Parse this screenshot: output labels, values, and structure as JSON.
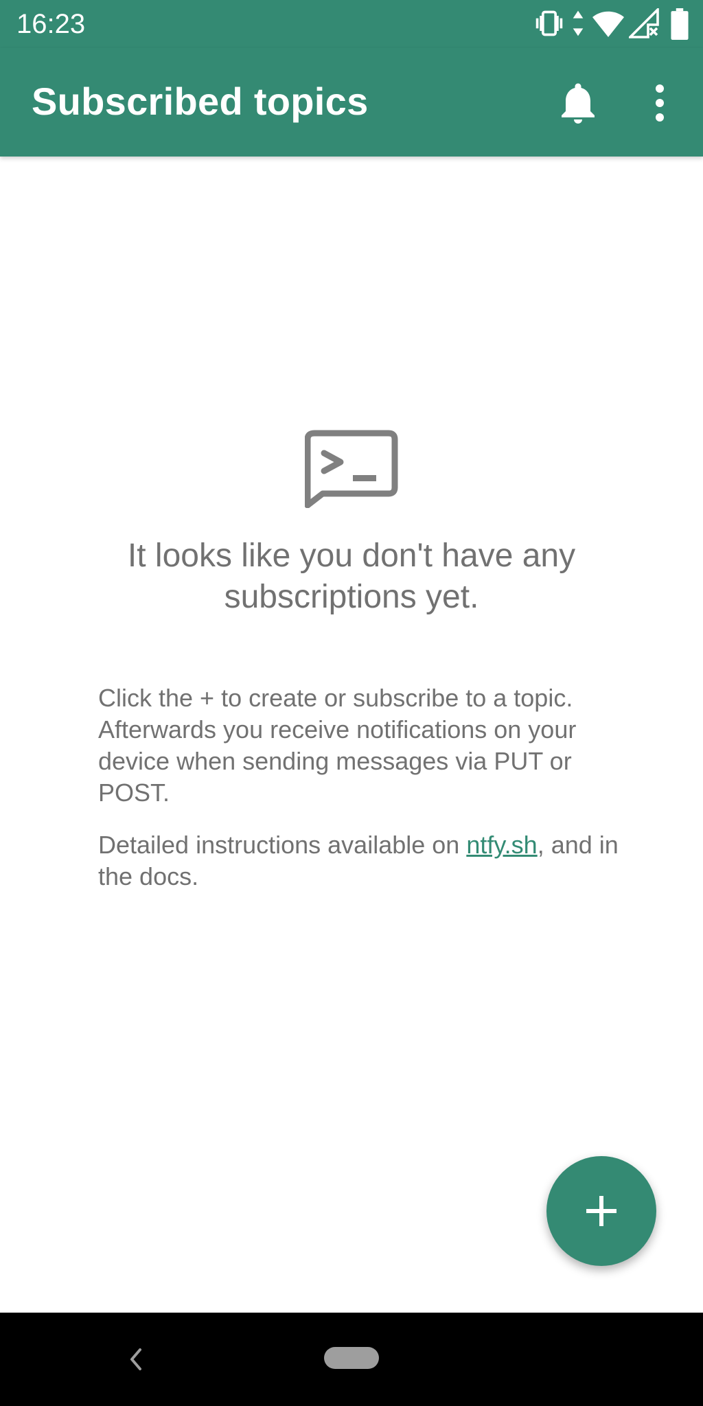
{
  "status_bar": {
    "time": "16:23",
    "icons": [
      "vibrate-icon",
      "data-arrows-icon",
      "wifi-icon",
      "signal-icon",
      "battery-icon"
    ]
  },
  "app_bar": {
    "title": "Subscribed topics",
    "icons": [
      "bell-icon",
      "more-vert-icon"
    ]
  },
  "empty_state": {
    "icon": "terminal-chat-icon",
    "title": "It looks like you don't have any subscriptions yet.",
    "description": "Click the + to create or subscribe to a topic. Afterwards you receive notifications on your device when sending messages via PUT or POST.",
    "instructions_prefix": "Detailed instructions available on ",
    "instructions_link": "ntfy.sh",
    "instructions_suffix": ", and in the docs."
  },
  "fab": {
    "icon": "plus-icon"
  },
  "nav_bar": {
    "icons": [
      "back-icon",
      "home-pill-icon"
    ]
  },
  "colors": {
    "primary": "#348a73",
    "text_secondary": "#717171",
    "link": "#338b74",
    "nav_background": "#000000"
  }
}
